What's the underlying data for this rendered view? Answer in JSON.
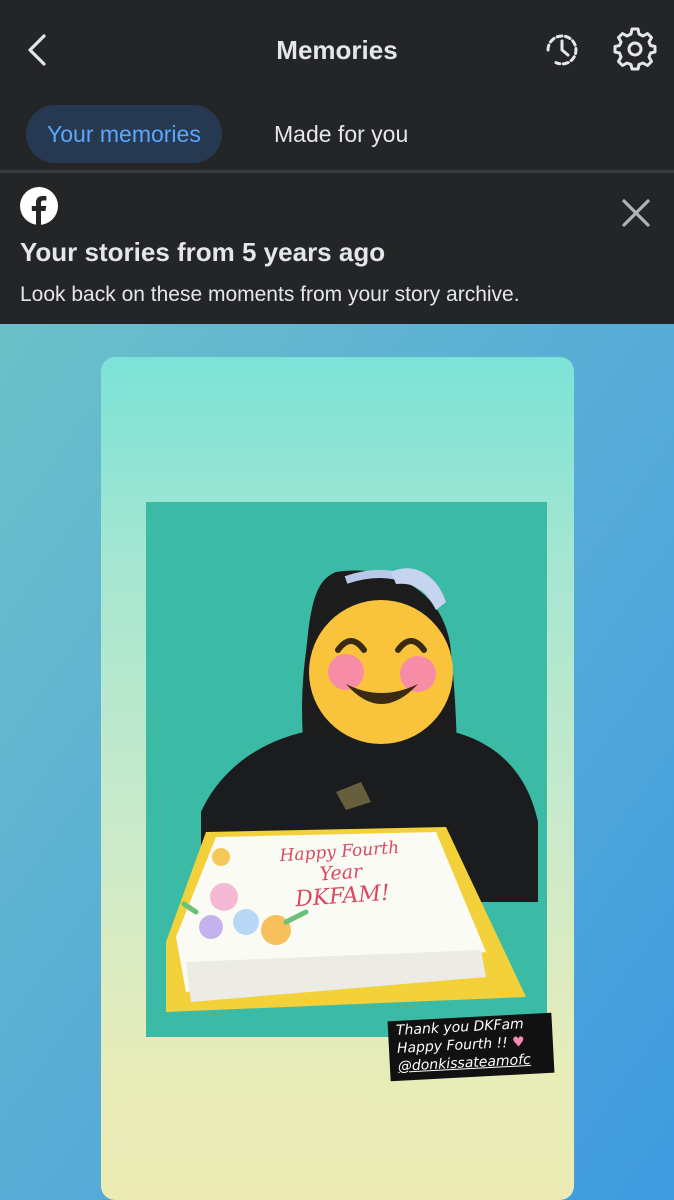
{
  "header": {
    "title": "Memories"
  },
  "tabs": [
    {
      "label": "Your memories",
      "active": true
    },
    {
      "label": "Made for you",
      "active": false
    }
  ],
  "banner": {
    "title": "Your stories from 5 years ago",
    "subtitle": "Look back on these moments from your story archive."
  },
  "story": {
    "cake_lines": [
      "Happy Fourth",
      "Year",
      "DKFAM!"
    ],
    "sticker_lines": [
      "Thank you DKFam",
      "Happy Fourth !!",
      "@donkissateamofc"
    ]
  },
  "colors": {
    "accent": "#5aa7ff",
    "active_tab_bg": "#263951",
    "bar_bg": "#242526"
  },
  "icons": [
    "back-icon",
    "history-icon",
    "settings-icon",
    "facebook-icon",
    "close-icon",
    "emoji-icon",
    "heart-icon"
  ]
}
